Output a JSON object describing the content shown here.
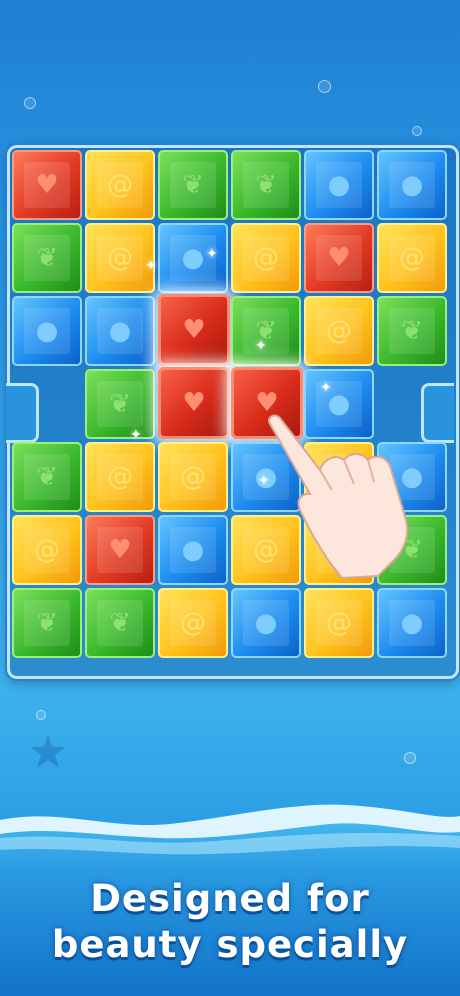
{
  "slogan": {
    "line1": "Designed for",
    "line2": "beauty specially"
  },
  "board": {
    "rows": [
      [
        "red",
        "yellow",
        "green",
        "green",
        "blue",
        "blue"
      ],
      [
        "green",
        "yellow",
        "blue",
        "yellow",
        "red",
        "yellow"
      ],
      [
        "blue",
        "blue",
        "red",
        "green",
        "yellow",
        "green"
      ],
      [
        "none",
        "green",
        "red",
        "red",
        "blue",
        "none"
      ],
      [
        "green",
        "yellow",
        "yellow",
        "blue",
        "yellow",
        "blue"
      ],
      [
        "yellow",
        "red",
        "blue",
        "yellow",
        "yellow",
        "green"
      ],
      [
        "green",
        "green",
        "yellow",
        "blue",
        "yellow",
        "blue"
      ]
    ],
    "selected_piece": [
      "r2c2",
      "r3c2",
      "r3c3"
    ]
  },
  "tile_symbols": {
    "red": "heart-icon",
    "green": "leaf-icon",
    "blue": "drop-icon",
    "yellow": "swirl-icon"
  },
  "colors": {
    "red": "#e23a24",
    "green": "#3ab82c",
    "blue": "#1c8cf0",
    "yellow": "#ffc21c",
    "background": "#2792e0"
  }
}
